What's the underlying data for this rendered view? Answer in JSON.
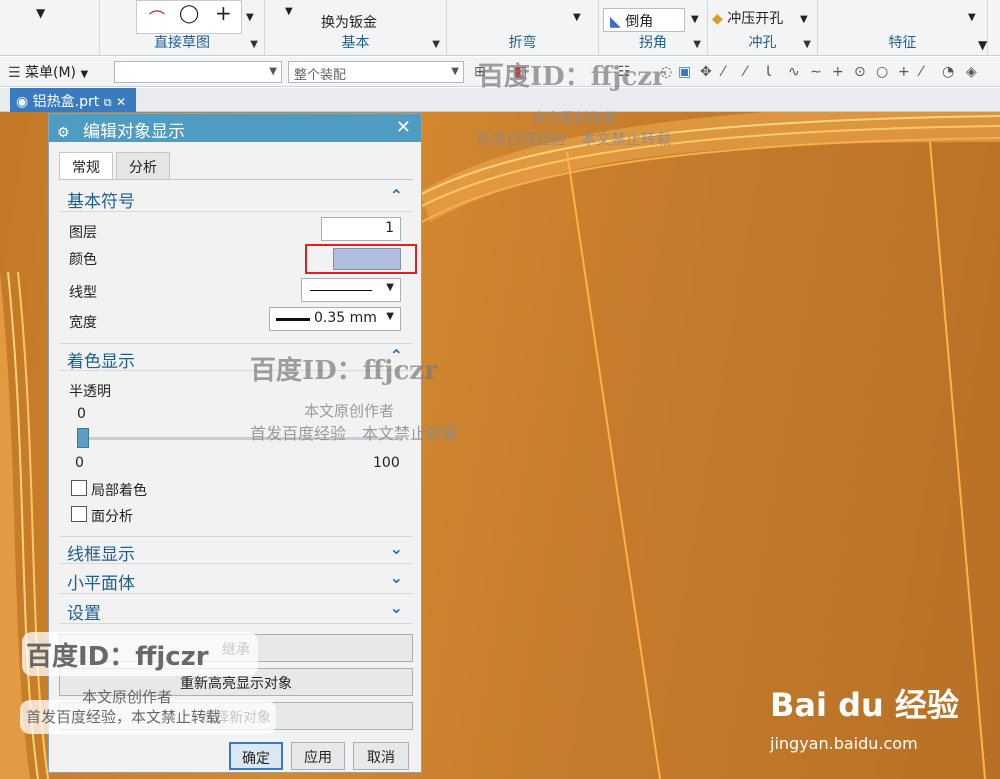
{
  "ribbon": {
    "groups": [
      "直接草图",
      "基本",
      "折弯",
      "拐角",
      "冲孔",
      "特征"
    ],
    "convert_sheet_label": "换为钣金",
    "chamfer_label": "倒角",
    "punch_label": "冲压开孔"
  },
  "toolbar": {
    "menu_label": "菜单(M)",
    "filter_value": "",
    "assembly_value": "整个装配"
  },
  "file_tab": {
    "label": "铝热盒.prt"
  },
  "dialog": {
    "title": "编辑对象显示",
    "tabs": [
      "常规",
      "分析"
    ],
    "sections": {
      "basic": "基本符号",
      "shading": "着色显示",
      "wireframe": "线框显示",
      "facets": "小平面体",
      "settings": "设置"
    },
    "layer_label": "图层",
    "layer_value": "1",
    "color_label": "颜色",
    "color_value": "#b0bfe0",
    "linetype_label": "线型",
    "width_label": "宽度",
    "width_value": "0.35 mm",
    "translucency_label": "半透明",
    "translucency_value": "0",
    "slider_min": "0",
    "slider_max": "100",
    "partial_shading_label": "局部着色",
    "face_analysis_label": "面分析",
    "inherit_button": "继承",
    "rehighlight_button": "重新高亮显示对象",
    "select_new_button": "选择新对象",
    "ok_button": "确定",
    "apply_button": "应用",
    "cancel_button": "取消"
  },
  "watermark": {
    "id_text": "百度ID：ffjczr",
    "line1": "本文原创作者",
    "line2": "首发百度经验　本文禁止转载",
    "line2_short": "首发百度经验，本文禁止转载",
    "brand": "Bai du 经验",
    "brand_url": "jingyan.baidu.com"
  }
}
